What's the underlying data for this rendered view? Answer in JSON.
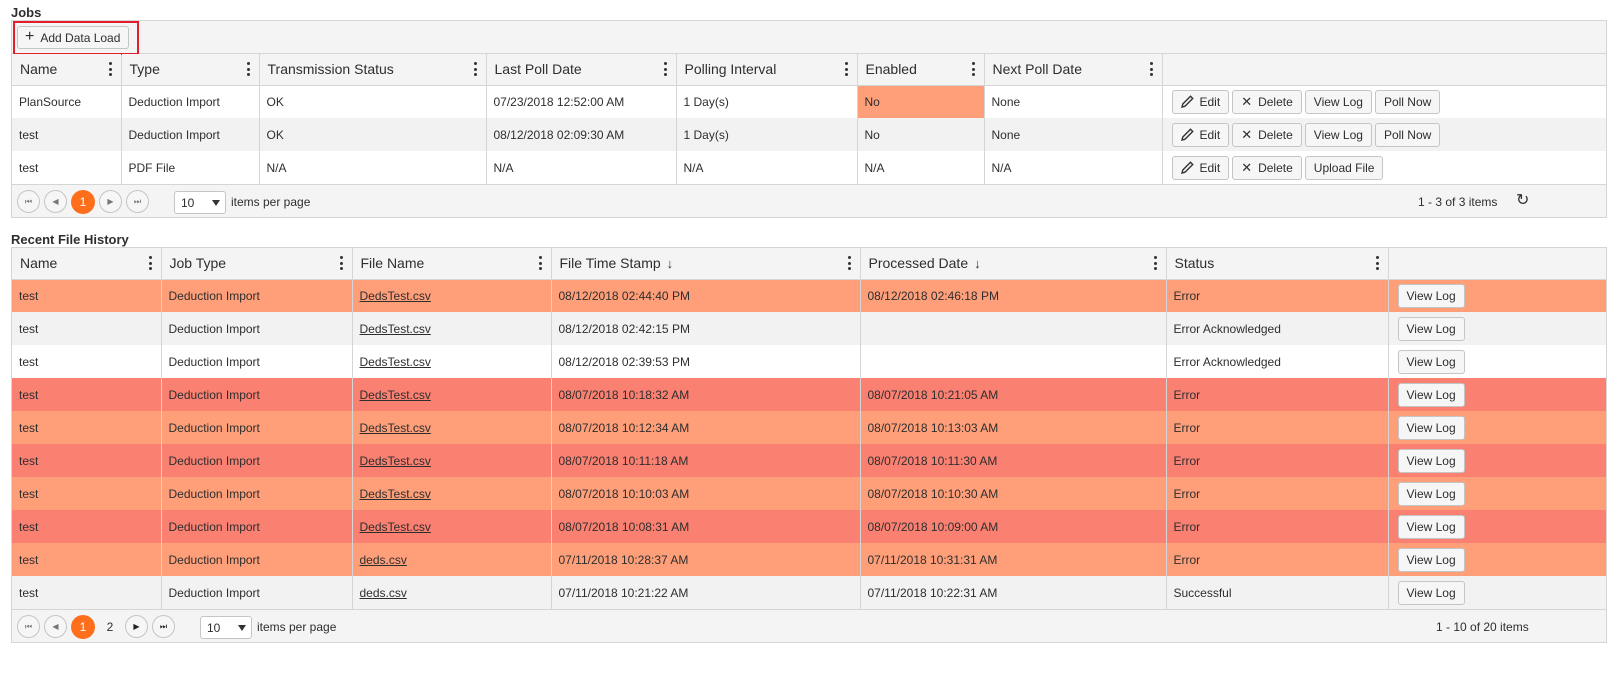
{
  "jobs": {
    "title": "Jobs",
    "add_button_label": "Add Data Load",
    "columns": [
      "Name",
      "Type",
      "Transmission Status",
      "Last Poll Date",
      "Polling Interval",
      "Enabled",
      "Next Poll Date"
    ],
    "rows": [
      {
        "name": "PlanSource",
        "type": "Deduction Import",
        "transmission_status": "OK",
        "last_poll_date": "07/23/2018 12:52:00 AM",
        "polling_interval": "1 Day(s)",
        "enabled": "No",
        "next_poll_date": "None",
        "actions": [
          "Edit",
          "Delete",
          "View Log",
          "Poll Now"
        ]
      },
      {
        "name": "test",
        "type": "Deduction Import",
        "transmission_status": "OK",
        "last_poll_date": "08/12/2018 02:09:30 AM",
        "polling_interval": "1 Day(s)",
        "enabled": "No",
        "next_poll_date": "None",
        "actions": [
          "Edit",
          "Delete",
          "View Log",
          "Poll Now"
        ]
      },
      {
        "name": "test",
        "type": "PDF File",
        "transmission_status": "N/A",
        "last_poll_date": "N/A",
        "polling_interval": "N/A",
        "enabled": "N/A",
        "next_poll_date": "N/A",
        "actions": [
          "Edit",
          "Delete",
          "Upload File"
        ]
      }
    ],
    "pager": {
      "current_page": "1",
      "page_size": "10",
      "items_per_page_label": "items per page",
      "info": "1 - 3 of 3 items"
    }
  },
  "history": {
    "title": "Recent File History",
    "columns": [
      "Name",
      "Job Type",
      "File Name",
      "File Time Stamp",
      "Processed Date",
      "Status"
    ],
    "view_log_label": "View Log",
    "rows": [
      {
        "name": "test",
        "job_type": "Deduction Import",
        "file_name": "DedsTest.csv",
        "file_time_stamp": "08/12/2018 02:44:40 PM",
        "processed_date": "08/12/2018 02:46:18 PM",
        "status": "Error",
        "row_color": "#ff9f79"
      },
      {
        "name": "test",
        "job_type": "Deduction Import",
        "file_name": "DedsTest.csv",
        "file_time_stamp": "08/12/2018 02:42:15 PM",
        "processed_date": "",
        "status": "Error Acknowledged",
        "row_color": "#f2f2f2"
      },
      {
        "name": "test",
        "job_type": "Deduction Import",
        "file_name": "DedsTest.csv",
        "file_time_stamp": "08/12/2018 02:39:53 PM",
        "processed_date": "",
        "status": "Error Acknowledged",
        "row_color": "#ffffff"
      },
      {
        "name": "test",
        "job_type": "Deduction Import",
        "file_name": "DedsTest.csv",
        "file_time_stamp": "08/07/2018 10:18:32 AM",
        "processed_date": "08/07/2018 10:21:05 AM",
        "status": "Error",
        "row_color": "#fa8072"
      },
      {
        "name": "test",
        "job_type": "Deduction Import",
        "file_name": "DedsTest.csv",
        "file_time_stamp": "08/07/2018 10:12:34 AM",
        "processed_date": "08/07/2018 10:13:03 AM",
        "status": "Error",
        "row_color": "#ff9f79"
      },
      {
        "name": "test",
        "job_type": "Deduction Import",
        "file_name": "DedsTest.csv",
        "file_time_stamp": "08/07/2018 10:11:18 AM",
        "processed_date": "08/07/2018 10:11:30 AM",
        "status": "Error",
        "row_color": "#fa8072"
      },
      {
        "name": "test",
        "job_type": "Deduction Import",
        "file_name": "DedsTest.csv",
        "file_time_stamp": "08/07/2018 10:10:03 AM",
        "processed_date": "08/07/2018 10:10:30 AM",
        "status": "Error",
        "row_color": "#ff9f79"
      },
      {
        "name": "test",
        "job_type": "Deduction Import",
        "file_name": "DedsTest.csv",
        "file_time_stamp": "08/07/2018 10:08:31 AM",
        "processed_date": "08/07/2018 10:09:00 AM",
        "status": "Error",
        "row_color": "#fa8072"
      },
      {
        "name": "test",
        "job_type": "Deduction Import",
        "file_name": "deds.csv",
        "file_time_stamp": "07/11/2018 10:28:37 AM",
        "processed_date": "07/11/2018 10:31:31 AM",
        "status": "Error",
        "row_color": "#ff9f79"
      },
      {
        "name": "test",
        "job_type": "Deduction Import",
        "file_name": "deds.csv",
        "file_time_stamp": "07/11/2018 10:21:22 AM",
        "processed_date": "07/11/2018 10:22:31 AM",
        "status": "Successful",
        "row_color": "#f2f2f2"
      }
    ],
    "pager": {
      "current_page": "1",
      "page_2": "2",
      "page_size": "10",
      "items_per_page_label": "items per page",
      "info": "1 - 10 of 20 items"
    }
  },
  "colors": {
    "accent": "#ff6f1b",
    "error": "#ff9f79",
    "error_dark": "#fa8072",
    "highlight_box": "#e41e2b",
    "disabled_cell": "#ff9f79"
  }
}
